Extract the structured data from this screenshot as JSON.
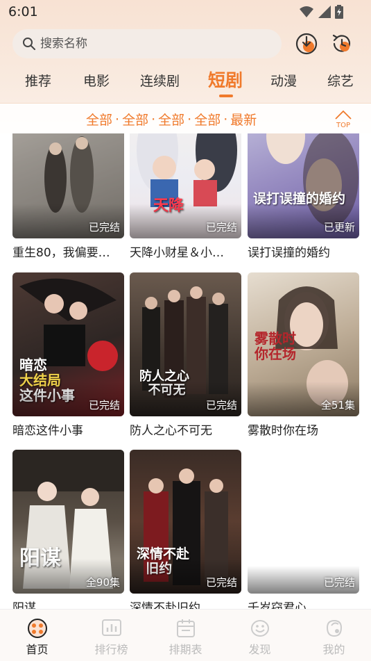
{
  "status_bar": {
    "time": "6:01"
  },
  "search": {
    "placeholder": "搜索名称"
  },
  "tabs": [
    {
      "label": "推荐"
    },
    {
      "label": "电影"
    },
    {
      "label": "连续剧"
    },
    {
      "label": "短剧",
      "active": true
    },
    {
      "label": "动漫"
    },
    {
      "label": "综艺"
    }
  ],
  "filters": [
    "全部",
    "全部",
    "全部",
    "全部",
    "最新"
  ],
  "top_button": {
    "label": "TOP"
  },
  "cards": [
    {
      "title": "重生80，我偏要…",
      "badge": "已完结",
      "poster_text": ""
    },
    {
      "title": "天降小财星＆小…",
      "badge": "已完结",
      "poster_text": "天降小财星"
    },
    {
      "title": "误打误撞的婚约",
      "badge": "已更新",
      "poster_text": "误打误撞的婚约"
    },
    {
      "title": "暗恋这件小事",
      "badge": "已完结",
      "poster_text": "暗恋大结局这件小事"
    },
    {
      "title": "防人之心不可无",
      "badge": "已完结",
      "poster_text": "防人之心不可无"
    },
    {
      "title": "雾散时你在场",
      "badge": "全51集",
      "poster_text": "雾散时你在场"
    },
    {
      "title": "阳谋",
      "badge": "全90集",
      "poster_text": "阳谋"
    },
    {
      "title": "深情不赴旧约",
      "badge": "已完结",
      "poster_text": "深情不赴旧约"
    },
    {
      "title": "千岁窃君心",
      "badge": "已完结",
      "poster_text": ""
    }
  ],
  "bottom_nav": [
    {
      "label": "首页",
      "active": true,
      "icon": "home-icon"
    },
    {
      "label": "排行榜",
      "icon": "chart-icon"
    },
    {
      "label": "排期表",
      "icon": "calendar-icon"
    },
    {
      "label": "发现",
      "icon": "discover-icon"
    },
    {
      "label": "我的",
      "icon": "user-icon"
    }
  ],
  "colors": {
    "accent": "#f07a2c",
    "header_bg": "#f8e2d3"
  }
}
